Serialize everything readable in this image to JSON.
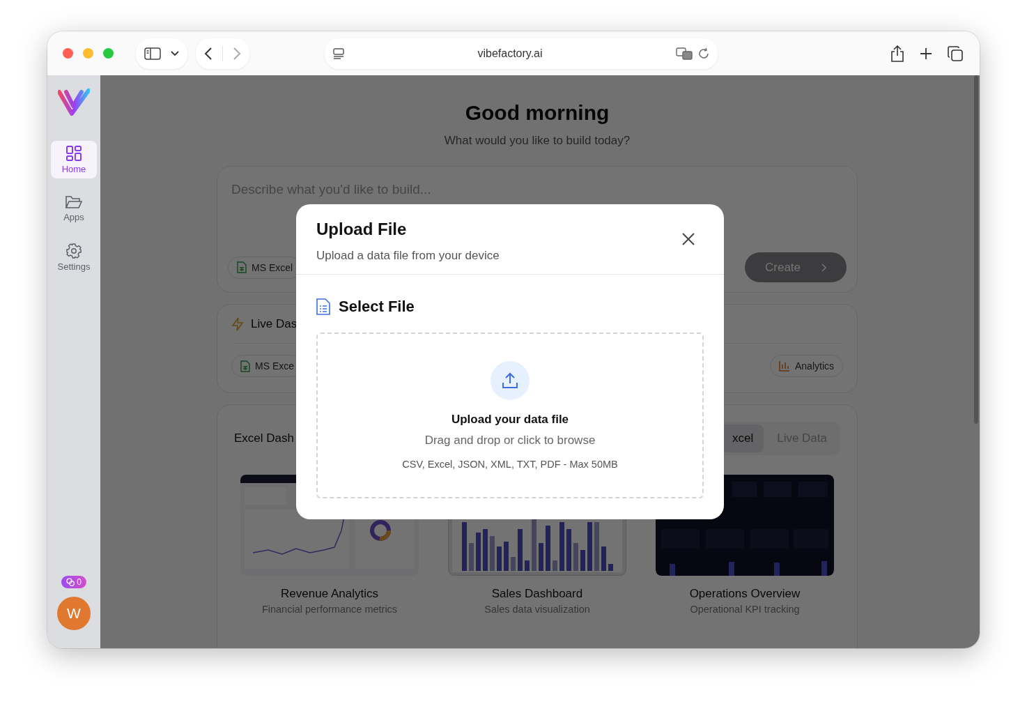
{
  "browser": {
    "url": "vibefactory.ai"
  },
  "sidebar": {
    "items": [
      {
        "label": "Home",
        "selected": true
      },
      {
        "label": "Apps",
        "selected": false
      },
      {
        "label": "Settings",
        "selected": false
      }
    ],
    "credits": "0",
    "avatar": "W"
  },
  "page": {
    "greeting": "Good morning",
    "subtitle": "What would you like to build today?",
    "prompt": {
      "placeholder": "Describe what you'd like to build...",
      "chips": [
        "MS Excel"
      ],
      "create_button": {
        "label": "Create",
        "disabled": true
      }
    },
    "live_section": {
      "title": "Live Das",
      "chips": [
        {
          "label": "MS Exce",
          "kind": "excel"
        },
        {
          "label": "Analytics",
          "kind": "analytics"
        }
      ]
    },
    "templates": {
      "title": "Excel Dash",
      "tabs": [
        {
          "label": "xcel",
          "selected": true
        },
        {
          "label": "Live Data",
          "selected": false
        }
      ],
      "cards": [
        {
          "title": "Revenue Analytics",
          "subtitle": "Financial performance metrics"
        },
        {
          "title": "Sales Dashboard",
          "subtitle": "Sales data visualization"
        },
        {
          "title": "Operations Overview",
          "subtitle": "Operational KPI tracking"
        }
      ]
    }
  },
  "modal": {
    "title": "Upload File",
    "subtitle": "Upload a data file from your device",
    "section_title": "Select File",
    "dropzone": {
      "heading": "Upload your data file",
      "hint": "Drag and drop or click to browse",
      "formats": "CSV, Excel, JSON, XML, TXT, PDF - Max 50MB"
    }
  }
}
